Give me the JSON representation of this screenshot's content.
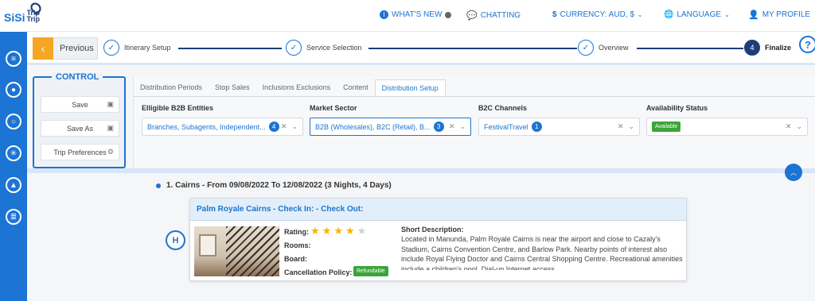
{
  "brand": {
    "name": "SiSi",
    "sub": "Trip"
  },
  "topnav": {
    "whats_new": "WHAT'S NEW",
    "chatting": "CHATTING",
    "currency": "CURRENCY: AUD, $",
    "language": "LANGUAGE",
    "profile": "MY PROFILE"
  },
  "colors": {
    "primary": "#1c74d4",
    "dark": "#1c3f7a",
    "accent": "#f5a623",
    "success": "#3aa53a"
  },
  "wizard": {
    "previous": "Previous",
    "steps": [
      {
        "label": "Itinerary Setup",
        "state": "done"
      },
      {
        "label": "Service Selection",
        "state": "done"
      },
      {
        "label": "Overview",
        "state": "done"
      },
      {
        "label": "Finalize",
        "number": "4",
        "state": "current"
      }
    ]
  },
  "control": {
    "title": "CONTROL",
    "buttons": [
      {
        "label": "Save"
      },
      {
        "label": "Save As"
      },
      {
        "label": "Trip Preferences"
      }
    ]
  },
  "tabs": [
    "Distribution Periods",
    "Stop Sales",
    "Inclusions Exclusions",
    "Content",
    "Distribution Setup"
  ],
  "active_tab": "Distribution Setup",
  "fields": [
    {
      "label": "Elligible B2B Entities",
      "value": "Branches, Subagents, Independent...",
      "count": "4"
    },
    {
      "label": "Market Sector",
      "value": "B2B (Wholesales), B2C (Retail), B...",
      "count": "3"
    },
    {
      "label": "B2C Channels",
      "value": "FestivalTravel",
      "count": "1"
    },
    {
      "label": "Availability Status",
      "value": "Available"
    }
  ],
  "itinerary": {
    "title": "1. Cairns - From 09/08/2022 To 12/08/2022 (3 Nights, 4 Days)"
  },
  "hotel": {
    "header": "Palm Royale Cairns - Check In: - Check Out:",
    "rating_label": "Rating:",
    "rating": 4,
    "rating_max": 5,
    "rooms_label": "Rooms:",
    "board_label": "Board:",
    "cancellation_label": "Cancellation Policy:",
    "cancellation_value": "Refundable",
    "desc_title": "Short Description:",
    "description": "Located in Manunda, Palm Royale Cairns is near the airport and close to Cazaly's Stadium, Cairns Convention Centre, and Barlow Park. Nearby points of interest also include Royal Flying Doctor and Cairns Central Shopping Centre. Recreational amenities include a children's pool. Dial-up Internet access"
  },
  "icons": {
    "hotel": "hotel-icon",
    "scroll_up": "chevron-up-icon",
    "help": "help-icon"
  }
}
